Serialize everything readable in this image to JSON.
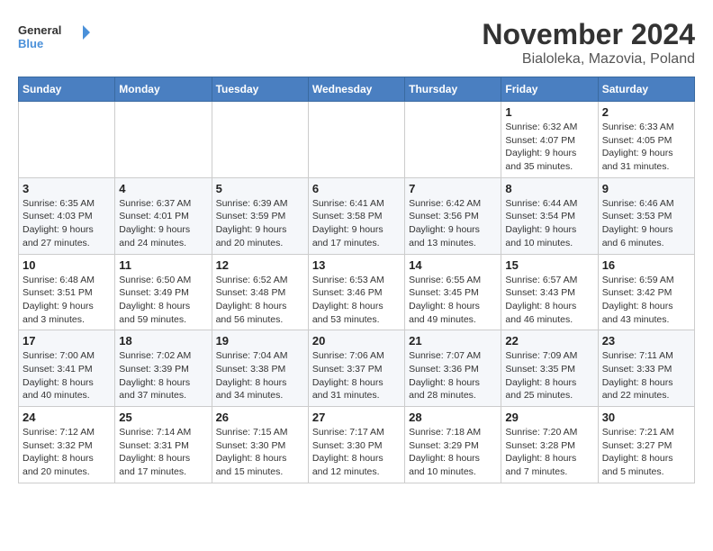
{
  "logo": {
    "line1": "General",
    "line2": "Blue"
  },
  "title": "November 2024",
  "location": "Bialoleka, Mazovia, Poland",
  "weekdays": [
    "Sunday",
    "Monday",
    "Tuesday",
    "Wednesday",
    "Thursday",
    "Friday",
    "Saturday"
  ],
  "weeks": [
    [
      {
        "day": "",
        "info": ""
      },
      {
        "day": "",
        "info": ""
      },
      {
        "day": "",
        "info": ""
      },
      {
        "day": "",
        "info": ""
      },
      {
        "day": "",
        "info": ""
      },
      {
        "day": "1",
        "info": "Sunrise: 6:32 AM\nSunset: 4:07 PM\nDaylight: 9 hours and 35 minutes."
      },
      {
        "day": "2",
        "info": "Sunrise: 6:33 AM\nSunset: 4:05 PM\nDaylight: 9 hours and 31 minutes."
      }
    ],
    [
      {
        "day": "3",
        "info": "Sunrise: 6:35 AM\nSunset: 4:03 PM\nDaylight: 9 hours and 27 minutes."
      },
      {
        "day": "4",
        "info": "Sunrise: 6:37 AM\nSunset: 4:01 PM\nDaylight: 9 hours and 24 minutes."
      },
      {
        "day": "5",
        "info": "Sunrise: 6:39 AM\nSunset: 3:59 PM\nDaylight: 9 hours and 20 minutes."
      },
      {
        "day": "6",
        "info": "Sunrise: 6:41 AM\nSunset: 3:58 PM\nDaylight: 9 hours and 17 minutes."
      },
      {
        "day": "7",
        "info": "Sunrise: 6:42 AM\nSunset: 3:56 PM\nDaylight: 9 hours and 13 minutes."
      },
      {
        "day": "8",
        "info": "Sunrise: 6:44 AM\nSunset: 3:54 PM\nDaylight: 9 hours and 10 minutes."
      },
      {
        "day": "9",
        "info": "Sunrise: 6:46 AM\nSunset: 3:53 PM\nDaylight: 9 hours and 6 minutes."
      }
    ],
    [
      {
        "day": "10",
        "info": "Sunrise: 6:48 AM\nSunset: 3:51 PM\nDaylight: 9 hours and 3 minutes."
      },
      {
        "day": "11",
        "info": "Sunrise: 6:50 AM\nSunset: 3:49 PM\nDaylight: 8 hours and 59 minutes."
      },
      {
        "day": "12",
        "info": "Sunrise: 6:52 AM\nSunset: 3:48 PM\nDaylight: 8 hours and 56 minutes."
      },
      {
        "day": "13",
        "info": "Sunrise: 6:53 AM\nSunset: 3:46 PM\nDaylight: 8 hours and 53 minutes."
      },
      {
        "day": "14",
        "info": "Sunrise: 6:55 AM\nSunset: 3:45 PM\nDaylight: 8 hours and 49 minutes."
      },
      {
        "day": "15",
        "info": "Sunrise: 6:57 AM\nSunset: 3:43 PM\nDaylight: 8 hours and 46 minutes."
      },
      {
        "day": "16",
        "info": "Sunrise: 6:59 AM\nSunset: 3:42 PM\nDaylight: 8 hours and 43 minutes."
      }
    ],
    [
      {
        "day": "17",
        "info": "Sunrise: 7:00 AM\nSunset: 3:41 PM\nDaylight: 8 hours and 40 minutes."
      },
      {
        "day": "18",
        "info": "Sunrise: 7:02 AM\nSunset: 3:39 PM\nDaylight: 8 hours and 37 minutes."
      },
      {
        "day": "19",
        "info": "Sunrise: 7:04 AM\nSunset: 3:38 PM\nDaylight: 8 hours and 34 minutes."
      },
      {
        "day": "20",
        "info": "Sunrise: 7:06 AM\nSunset: 3:37 PM\nDaylight: 8 hours and 31 minutes."
      },
      {
        "day": "21",
        "info": "Sunrise: 7:07 AM\nSunset: 3:36 PM\nDaylight: 8 hours and 28 minutes."
      },
      {
        "day": "22",
        "info": "Sunrise: 7:09 AM\nSunset: 3:35 PM\nDaylight: 8 hours and 25 minutes."
      },
      {
        "day": "23",
        "info": "Sunrise: 7:11 AM\nSunset: 3:33 PM\nDaylight: 8 hours and 22 minutes."
      }
    ],
    [
      {
        "day": "24",
        "info": "Sunrise: 7:12 AM\nSunset: 3:32 PM\nDaylight: 8 hours and 20 minutes."
      },
      {
        "day": "25",
        "info": "Sunrise: 7:14 AM\nSunset: 3:31 PM\nDaylight: 8 hours and 17 minutes."
      },
      {
        "day": "26",
        "info": "Sunrise: 7:15 AM\nSunset: 3:30 PM\nDaylight: 8 hours and 15 minutes."
      },
      {
        "day": "27",
        "info": "Sunrise: 7:17 AM\nSunset: 3:30 PM\nDaylight: 8 hours and 12 minutes."
      },
      {
        "day": "28",
        "info": "Sunrise: 7:18 AM\nSunset: 3:29 PM\nDaylight: 8 hours and 10 minutes."
      },
      {
        "day": "29",
        "info": "Sunrise: 7:20 AM\nSunset: 3:28 PM\nDaylight: 8 hours and 7 minutes."
      },
      {
        "day": "30",
        "info": "Sunrise: 7:21 AM\nSunset: 3:27 PM\nDaylight: 8 hours and 5 minutes."
      }
    ]
  ]
}
